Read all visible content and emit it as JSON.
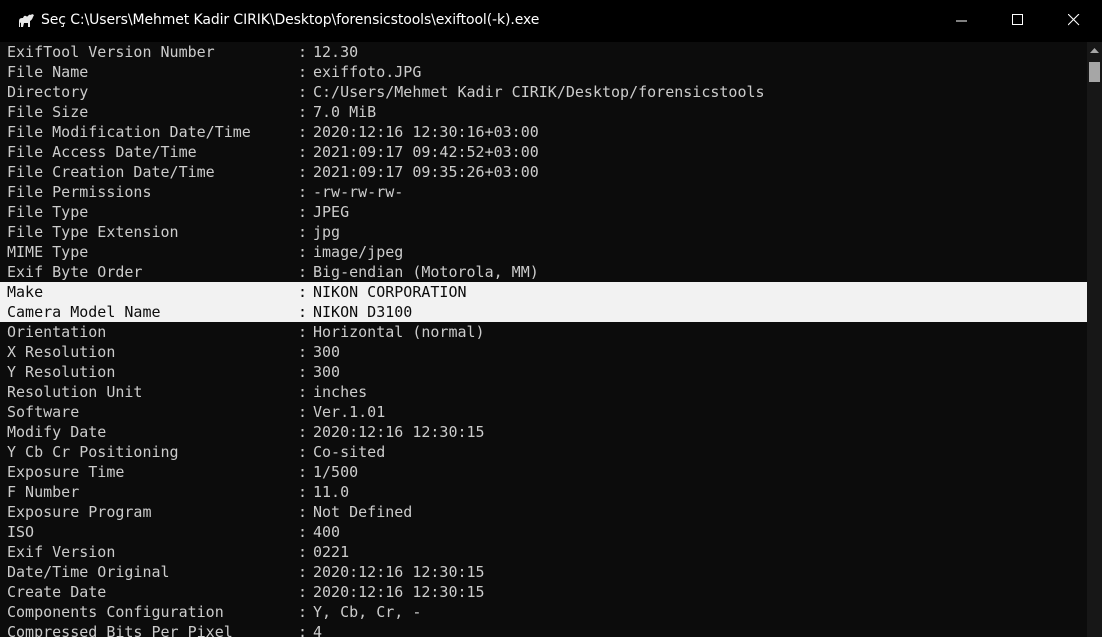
{
  "window": {
    "title": "Seç C:\\Users\\Mehmet Kadir CIRIK\\Desktop\\forensicstools\\exiftool(-k).exe",
    "icon": "camel-icon",
    "controls": {
      "minimize": "minimize-icon",
      "maximize": "maximize-icon",
      "close": "close-icon"
    }
  },
  "console": {
    "separator": ":",
    "selected_rows": [
      12,
      13
    ],
    "colors": {
      "background": "#0c0c0c",
      "text": "#cccccc",
      "selection_bg": "#f2f2f2",
      "selection_text": "#0c0c0c"
    },
    "rows": [
      {
        "tag": "ExifTool Version Number",
        "value": "12.30"
      },
      {
        "tag": "File Name",
        "value": "exiffoto.JPG"
      },
      {
        "tag": "Directory",
        "value": "C:/Users/Mehmet Kadir CIRIK/Desktop/forensicstools"
      },
      {
        "tag": "File Size",
        "value": "7.0 MiB"
      },
      {
        "tag": "File Modification Date/Time",
        "value": "2020:12:16 12:30:16+03:00"
      },
      {
        "tag": "File Access Date/Time",
        "value": "2021:09:17 09:42:52+03:00"
      },
      {
        "tag": "File Creation Date/Time",
        "value": "2021:09:17 09:35:26+03:00"
      },
      {
        "tag": "File Permissions",
        "value": "-rw-rw-rw-"
      },
      {
        "tag": "File Type",
        "value": "JPEG"
      },
      {
        "tag": "File Type Extension",
        "value": "jpg"
      },
      {
        "tag": "MIME Type",
        "value": "image/jpeg"
      },
      {
        "tag": "Exif Byte Order",
        "value": "Big-endian (Motorola, MM)"
      },
      {
        "tag": "Make",
        "value": "NIKON CORPORATION"
      },
      {
        "tag": "Camera Model Name",
        "value": "NIKON D3100"
      },
      {
        "tag": "Orientation",
        "value": "Horizontal (normal)"
      },
      {
        "tag": "X Resolution",
        "value": "300"
      },
      {
        "tag": "Y Resolution",
        "value": "300"
      },
      {
        "tag": "Resolution Unit",
        "value": "inches"
      },
      {
        "tag": "Software",
        "value": "Ver.1.01"
      },
      {
        "tag": "Modify Date",
        "value": "2020:12:16 12:30:15"
      },
      {
        "tag": "Y Cb Cr Positioning",
        "value": "Co-sited"
      },
      {
        "tag": "Exposure Time",
        "value": "1/500"
      },
      {
        "tag": "F Number",
        "value": "11.0"
      },
      {
        "tag": "Exposure Program",
        "value": "Not Defined"
      },
      {
        "tag": "ISO",
        "value": "400"
      },
      {
        "tag": "Exif Version",
        "value": "0221"
      },
      {
        "tag": "Date/Time Original",
        "value": "2020:12:16 12:30:15"
      },
      {
        "tag": "Create Date",
        "value": "2020:12:16 12:30:15"
      },
      {
        "tag": "Components Configuration",
        "value": "Y, Cb, Cr, -"
      },
      {
        "tag": "Compressed Bits Per Pixel",
        "value": "4"
      }
    ]
  },
  "scrollbar": {
    "up_arrow": "scroll-up-icon",
    "position": 0.0
  }
}
